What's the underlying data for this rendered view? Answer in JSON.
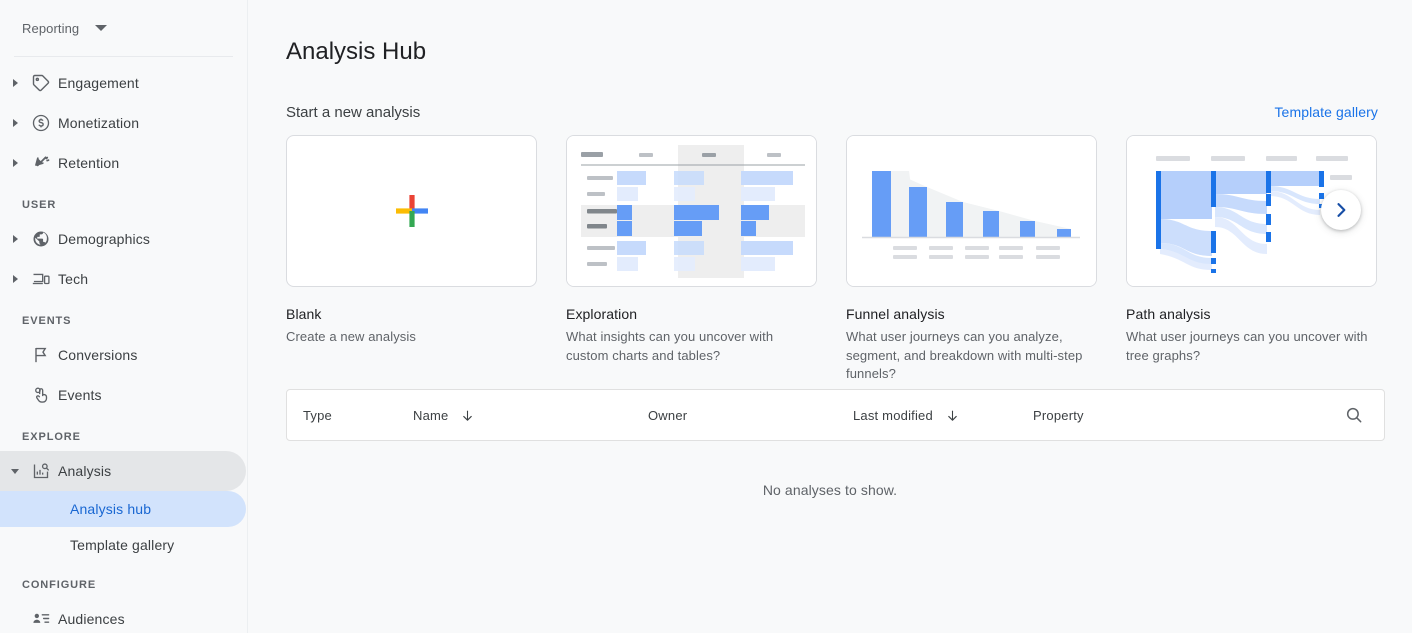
{
  "sidebar": {
    "account_switcher": {
      "label": "Reporting",
      "icon": "chevron-down-icon"
    },
    "groups": [
      {
        "title": null,
        "items": [
          {
            "label": "Engagement",
            "icon": "tag-icon",
            "expandable": true,
            "expanded": false
          },
          {
            "label": "Monetization",
            "icon": "dollar-circle-icon",
            "expandable": true,
            "expanded": false
          },
          {
            "label": "Retention",
            "icon": "retention-icon",
            "expandable": true,
            "expanded": false
          }
        ]
      },
      {
        "title": "USER",
        "items": [
          {
            "label": "Demographics",
            "icon": "globe-icon",
            "expandable": true,
            "expanded": false
          },
          {
            "label": "Tech",
            "icon": "devices-icon",
            "expandable": true,
            "expanded": false
          }
        ]
      },
      {
        "title": "EVENTS",
        "items": [
          {
            "label": "Conversions",
            "icon": "flag-icon",
            "expandable": false,
            "expanded": false
          },
          {
            "label": "Events",
            "icon": "touch-icon",
            "expandable": false,
            "expanded": false
          }
        ]
      },
      {
        "title": "EXPLORE",
        "items": [
          {
            "label": "Analysis",
            "icon": "analysis-icon",
            "expandable": true,
            "expanded": true,
            "selected": true
          }
        ],
        "sub_items": [
          {
            "label": "Analysis hub",
            "active": true
          },
          {
            "label": "Template gallery",
            "active": false
          }
        ]
      },
      {
        "title": "CONFIGURE",
        "items": [
          {
            "label": "Audiences",
            "icon": "audiences-icon",
            "expandable": false,
            "expanded": false
          }
        ]
      }
    ]
  },
  "header": {
    "page_title": "Analysis Hub"
  },
  "start_section": {
    "title": "Start a new analysis",
    "template_gallery_link": "Template gallery",
    "next_button_icon": "chevron-right-icon",
    "cards": [
      {
        "name": "Blank",
        "description": "Create a new analysis",
        "thumb": "blank-plus"
      },
      {
        "name": "Exploration",
        "description": "What insights can you uncover with custom charts and tables?",
        "thumb": "exploration-table"
      },
      {
        "name": "Funnel analysis",
        "description": "What user journeys can you analyze, segment, and breakdown with multi-step funnels?",
        "thumb": "funnel-bars"
      },
      {
        "name": "Path analysis",
        "description": "What user journeys can you uncover with tree graphs?",
        "thumb": "path-sankey"
      }
    ]
  },
  "analyses_table": {
    "columns": [
      {
        "label": "Type",
        "sortable": false
      },
      {
        "label": "Name",
        "sortable": true,
        "sort_icon": "arrow-down-icon"
      },
      {
        "label": "Owner",
        "sortable": false
      },
      {
        "label": "Last modified",
        "sortable": true,
        "sort_icon": "arrow-down-icon"
      },
      {
        "label": "Property",
        "sortable": false
      }
    ],
    "search_icon": "search-icon",
    "empty_message": "No analyses to show.",
    "rows": []
  },
  "colors": {
    "accent_blue": "#1a73e8",
    "active_nav_bg": "#d2e3fc",
    "active_nav_text": "#1967d2",
    "plus_red": "#ea4335",
    "plus_yellow": "#fbbc04",
    "plus_blue": "#4285f4",
    "plus_green": "#34a853",
    "chart_blue": "#669df6",
    "chart_blue_light": "#c6dafc",
    "chart_blue_lighter": "#e3ecfd",
    "page_bg": "#f8f9fa"
  }
}
